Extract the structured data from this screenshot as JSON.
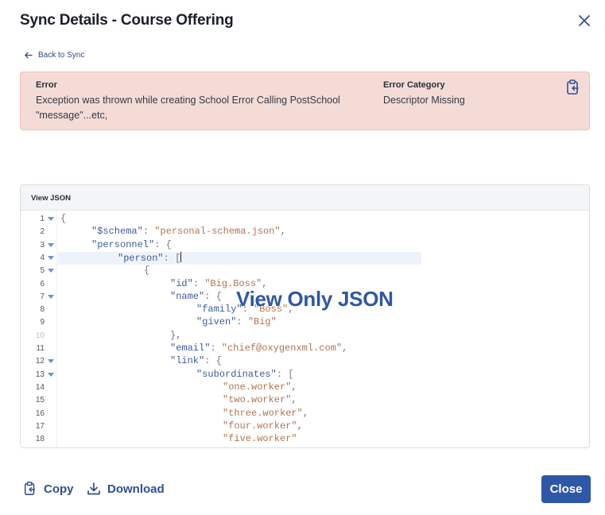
{
  "dialog": {
    "title": "Sync Details - Course Offering",
    "back_label": "Back to Sync"
  },
  "error": {
    "error_heading": "Error",
    "error_line1": "Exception was thrown while creating School Error Calling PostSchool",
    "error_line2": "\"message\"...etc,",
    "category_heading": "Error Category",
    "category_value": "Descriptor Missing"
  },
  "json_view": {
    "header": "View JSON",
    "overlay": "View Only JSON",
    "lines": [
      {
        "n": "1",
        "fold": true,
        "indent": 0,
        "parts": [
          [
            "p",
            "{"
          ]
        ]
      },
      {
        "n": "2",
        "fold": false,
        "indent": 1,
        "parts": [
          [
            "k",
            "\"$schema\""
          ],
          [
            "p",
            ": "
          ],
          [
            "s",
            "\"personal-schema.json\""
          ],
          [
            "p",
            ","
          ]
        ]
      },
      {
        "n": "3",
        "fold": true,
        "indent": 1,
        "parts": [
          [
            "k",
            "\"personnel\""
          ],
          [
            "p",
            ": {"
          ]
        ]
      },
      {
        "n": "4",
        "fold": true,
        "indent": 2,
        "parts": [
          [
            "k",
            "\"person\""
          ],
          [
            "p",
            ": ["
          ]
        ],
        "cursor": true,
        "active": true
      },
      {
        "n": "5",
        "fold": true,
        "indent": 3,
        "parts": [
          [
            "p",
            "{"
          ]
        ]
      },
      {
        "n": "6",
        "fold": false,
        "indent": 4,
        "parts": [
          [
            "k",
            "\"id\""
          ],
          [
            "p",
            ": "
          ],
          [
            "s",
            "\"Big.Boss\""
          ],
          [
            "p",
            ","
          ]
        ]
      },
      {
        "n": "7",
        "fold": true,
        "indent": 4,
        "parts": [
          [
            "k",
            "\"name\""
          ],
          [
            "p",
            ": {"
          ]
        ]
      },
      {
        "n": "8",
        "fold": false,
        "indent": 5,
        "parts": [
          [
            "k",
            "\"family\""
          ],
          [
            "p",
            ": "
          ],
          [
            "s",
            "\"Boss\""
          ],
          [
            "p",
            ","
          ]
        ]
      },
      {
        "n": "9",
        "fold": false,
        "indent": 5,
        "parts": [
          [
            "k",
            "\"given\""
          ],
          [
            "p",
            ": "
          ],
          [
            "s",
            "\"Big\""
          ]
        ]
      },
      {
        "n": "10",
        "fold": false,
        "indent": 4,
        "faded": true,
        "parts": [
          [
            "p",
            "},"
          ]
        ]
      },
      {
        "n": "11",
        "fold": false,
        "indent": 4,
        "parts": [
          [
            "k",
            "\"email\""
          ],
          [
            "p",
            ": "
          ],
          [
            "s",
            "\"chief@oxygenxml.com\""
          ],
          [
            "p",
            ","
          ]
        ]
      },
      {
        "n": "12",
        "fold": true,
        "indent": 4,
        "parts": [
          [
            "k",
            "\"link\""
          ],
          [
            "p",
            ": {"
          ]
        ]
      },
      {
        "n": "13",
        "fold": true,
        "indent": 5,
        "parts": [
          [
            "k",
            "\"subordinates\""
          ],
          [
            "p",
            ": ["
          ]
        ]
      },
      {
        "n": "14",
        "fold": false,
        "indent": 6,
        "parts": [
          [
            "s",
            "\"one.worker\""
          ],
          [
            "p",
            ","
          ]
        ]
      },
      {
        "n": "15",
        "fold": false,
        "indent": 6,
        "parts": [
          [
            "s",
            "\"two.worker\""
          ],
          [
            "p",
            ","
          ]
        ]
      },
      {
        "n": "16",
        "fold": false,
        "indent": 6,
        "parts": [
          [
            "s",
            "\"three.worker\""
          ],
          [
            "p",
            ","
          ]
        ]
      },
      {
        "n": "17",
        "fold": false,
        "indent": 6,
        "parts": [
          [
            "s",
            "\"four.worker\""
          ],
          [
            "p",
            ","
          ]
        ]
      },
      {
        "n": "18",
        "fold": false,
        "indent": 6,
        "parts": [
          [
            "s",
            "\"five.worker\""
          ]
        ]
      }
    ]
  },
  "footer": {
    "copy_label": "Copy",
    "download_label": "Download",
    "close_label": "Close"
  },
  "colors": {
    "accent": "#2f57a7",
    "error_bg": "#f4dbd6",
    "json_key": "#3d5aa0",
    "json_string": "#b5744d"
  },
  "icons": {
    "close": "close-icon",
    "back": "arrow-left-icon",
    "clipboard": "clipboard-copy-icon",
    "copy": "clipboard-copy-icon",
    "download": "download-icon"
  }
}
